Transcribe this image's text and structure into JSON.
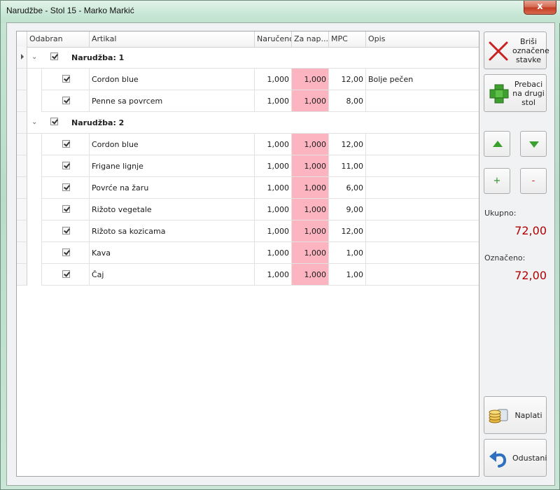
{
  "window": {
    "title": "Narudžbe - Stol 15 - Marko Markić",
    "close_label": "x"
  },
  "grid": {
    "columns": [
      "Odabran",
      "Artikal",
      "Naručeno",
      "Za nap...",
      "MPC",
      "Opis"
    ],
    "groups": [
      {
        "label": "Narudžba: 1",
        "checked": true,
        "rows": [
          {
            "checked": true,
            "artikal": "Cordon blue",
            "naruceno": "1,000",
            "za_naplatu": "1,000",
            "mpc": "12,00",
            "opis": "Bolje pečen"
          },
          {
            "checked": true,
            "artikal": "Penne sa povrcem",
            "naruceno": "1,000",
            "za_naplatu": "1,000",
            "mpc": "8,00",
            "opis": ""
          }
        ]
      },
      {
        "label": "Narudžba: 2",
        "checked": true,
        "rows": [
          {
            "checked": true,
            "artikal": "Cordon blue",
            "naruceno": "1,000",
            "za_naplatu": "1,000",
            "mpc": "12,00",
            "opis": ""
          },
          {
            "checked": true,
            "artikal": "Frigane lignje",
            "naruceno": "1,000",
            "za_naplatu": "1,000",
            "mpc": "11,00",
            "opis": ""
          },
          {
            "checked": true,
            "artikal": "Povrće na žaru",
            "naruceno": "1,000",
            "za_naplatu": "1,000",
            "mpc": "6,00",
            "opis": ""
          },
          {
            "checked": true,
            "artikal": "Rižoto vegetale",
            "naruceno": "1,000",
            "za_naplatu": "1,000",
            "mpc": "9,00",
            "opis": ""
          },
          {
            "checked": true,
            "artikal": "Rižoto sa kozicama",
            "naruceno": "1,000",
            "za_naplatu": "1,000",
            "mpc": "12,00",
            "opis": ""
          },
          {
            "checked": true,
            "artikal": "Kava",
            "naruceno": "1,000",
            "za_naplatu": "1,000",
            "mpc": "1,00",
            "opis": ""
          },
          {
            "checked": true,
            "artikal": "Čaj",
            "naruceno": "1,000",
            "za_naplatu": "1,000",
            "mpc": "1,00",
            "opis": ""
          }
        ]
      }
    ]
  },
  "sidebar": {
    "delete_label": "Briši označene stavke",
    "transfer_label": "Prebaci na drugi stol",
    "plus_label": "+",
    "minus_label": "-",
    "total_label": "Ukupno:",
    "total_value": "72,00",
    "marked_label": "Označeno:",
    "marked_value": "72,00",
    "pay_label": "Naplati",
    "cancel_label": "Odustani"
  },
  "colors": {
    "highlight_cell": "#fcb5c0",
    "total_text": "#b00000",
    "arrow_green": "#3aa12f"
  }
}
